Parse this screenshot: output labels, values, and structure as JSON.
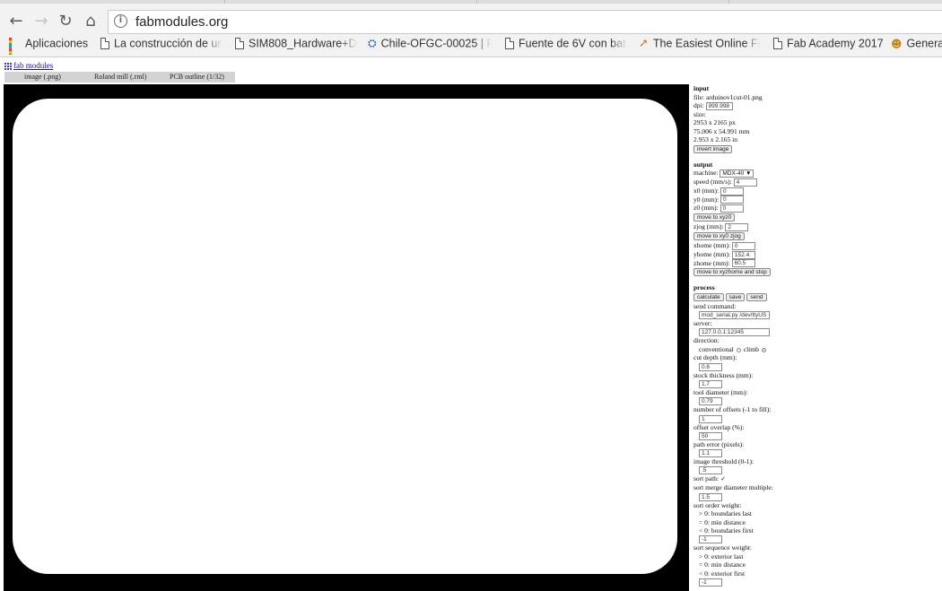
{
  "browser": {
    "url": "fabmodules.org",
    "bookmarks": [
      {
        "label": "Aplicaciones",
        "icon": "apps-icon"
      },
      {
        "label": "La construcción de un",
        "icon": "document-icon"
      },
      {
        "label": "SIM808_Hardware+De",
        "icon": "document-icon"
      },
      {
        "label": "Chile-OFGC-00025 | P",
        "icon": "map-icon"
      },
      {
        "label": "Fuente de 6V con bat",
        "icon": "document-icon"
      },
      {
        "label": "The Easiest Online For",
        "icon": "bolt-icon"
      },
      {
        "label": "Fab Academy 2017",
        "icon": "document-icon"
      },
      {
        "label": "Genera",
        "icon": "person-icon"
      }
    ]
  },
  "app": {
    "title": "fab modules",
    "tabs": [
      "image (.png)",
      "Roland mill (.rml)",
      "PCB outline (1/32)"
    ]
  },
  "input": {
    "heading": "input",
    "file_label": "file: arduinov1cut-01.png",
    "dpi_label": "dpi:",
    "dpi_value": "999.998",
    "size_label": "size:",
    "size_px": "2953 x 2165 px",
    "size_mm": "75.006 x 54.991 mm",
    "size_in": "2.953 x 2.165 in",
    "invert_label": "invert image"
  },
  "output": {
    "heading": "output",
    "machine_label": "machine:",
    "machine_value": "MDX-40",
    "speed_label": "speed (mm/s):",
    "speed_value": "4",
    "x0_label": "x0 (mm):",
    "x0_value": "0",
    "y0_label": "y0 (mm):",
    "y0_value": "0",
    "z0_label": "z0 (mm):",
    "z0_value": "0",
    "move_xyz0_label": "move to xyz0",
    "zjog_label": "zjog (mm):",
    "zjog_value": "2",
    "move_xy0_label": "move to xy0 zjog",
    "xhome_label": "xhome (mm):",
    "xhome_value": "0",
    "yhome_label": "yhome (mm):",
    "yhome_value": "152.4",
    "zhome_label": "zhome (mm):",
    "zhome_value": "60.5",
    "move_home_label": "move to xyzhome and stop"
  },
  "process": {
    "heading": "process",
    "calculate_label": "calculate",
    "save_label": "save",
    "send_label": "send",
    "send_command_label": "send command:",
    "send_command_value": "mod_serial.py /dev/ttyUS",
    "server_label": "server:",
    "server_value": "127.0.0.1:12345",
    "direction_label": "direction:",
    "conventional_label": "conventional",
    "climb_label": "climb",
    "cut_depth_label": "cut depth (mm):",
    "cut_depth_value": "0.6",
    "stock_label": "stock thickness (mm):",
    "stock_value": "1.7",
    "tool_label": "tool diameter (mm):",
    "tool_value": "0.79",
    "offsets_label": "number of offsets (-1 to fill):",
    "offsets_value": "1",
    "overlap_label": "offset overlap (%):",
    "overlap_value": "50",
    "path_error_label": "path error (pixels):",
    "path_error_value": "1.1",
    "threshold_label": "image threshold (0-1):",
    "threshold_value": ".5",
    "sort_path_label": "sort path:",
    "merge_label": "sort merge diameter multiple:",
    "merge_value": "1.5",
    "order_label": "sort order weight:",
    "order_opt1": "> 0: boundaries last",
    "order_opt2": "= 0: min distance",
    "order_opt3": "< 0: boundaries first",
    "order_value": "-1",
    "sequence_label": "sort sequence weight:",
    "seq_opt1": "> 0: exterior last",
    "seq_opt2": "= 0: min distance",
    "seq_opt3": "< 0: exterior first",
    "seq_value": "-1"
  },
  "colors": {
    "canvas_bg": "#000000",
    "board": "#ffffff",
    "tab_bar": "#d3d3d3"
  }
}
